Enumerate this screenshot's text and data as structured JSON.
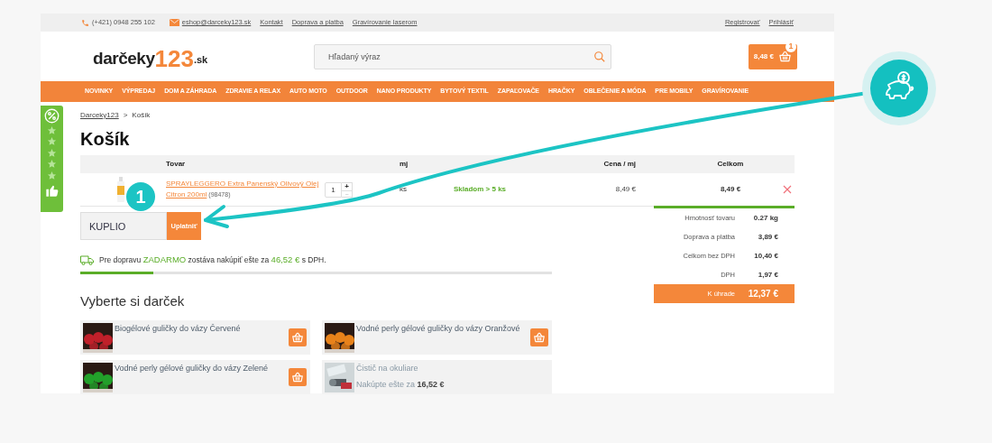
{
  "topbar": {
    "phone": "(+421) 0948 255 102",
    "email": "eshop@darceky123.sk",
    "links": [
      "Kontakt",
      "Doprava a platba",
      "Gravírovanie laserom"
    ],
    "account_links": [
      "Registrovať",
      "Prihlásiť"
    ]
  },
  "header": {
    "logo": {
      "name": "darčeky",
      "number": "123",
      "tld": ".sk"
    },
    "search": {
      "placeholder": "Hľadaný výraz"
    },
    "cart": {
      "total": "8,48 €",
      "count": "1"
    }
  },
  "nav": [
    "NOVINKY",
    "VÝPREDAJ",
    "DOM A ZÁHRADA",
    "ZDRAVIE A RELAX",
    "AUTO MOTO",
    "OUTDOOR",
    "NANO PRODUKTY",
    "BYTOVÝ TEXTIL",
    "ZAPAĽOVAČE",
    "HRAČKY",
    "OBLEČENIE A MÓDA",
    "PRE MOBILY",
    "GRAVÍROVANIE"
  ],
  "breadcrumb": {
    "items": [
      "Darceky123",
      "Košík"
    ],
    "separator": ">"
  },
  "title": "Košík",
  "table": {
    "columns": {
      "product": "Tovar",
      "unit": "mj",
      "price": "Cena / mj",
      "total": "Celkom"
    },
    "rows": [
      {
        "name": "SPRAYLEGGERO Extra Panenský Olivový Olej Citron 200ml",
        "code": "(98478)",
        "qty": "1",
        "plus": "+",
        "minus": "−",
        "unit": "ks",
        "stock": "Skladom > 5 ks",
        "price": "8,49 €",
        "total": "8,49 €"
      }
    ]
  },
  "coupon": {
    "value": "KUPLIO",
    "button": "Uplatniť"
  },
  "shipping": {
    "prefix": "Pre dopravu",
    "highlight": "ZADARMO",
    "middle": "zostáva nakúpiť ešte za",
    "amount": "46,52 €",
    "suffix": "s DPH.",
    "level": 0.155
  },
  "summary": {
    "rows": [
      {
        "label": "Hmotnosť tovaru",
        "value": "0.27 kg"
      },
      {
        "label": "Doprava a platba",
        "value": "3,89 €"
      },
      {
        "label": "Celkom bez DPH",
        "value": "10,40 €"
      },
      {
        "label": "DPH",
        "value": "1,97 €"
      }
    ],
    "total": {
      "label": "K úhrade",
      "value": "12,37 €"
    }
  },
  "gifts": {
    "title": "Vyberte si darček",
    "items": [
      {
        "kind": "available",
        "name": "Biogélové guličky do vázy Červené"
      },
      {
        "kind": "available",
        "name": "Vodné perly gélové guličky do vázy Oranžové"
      },
      {
        "kind": "available",
        "name": "Vodné perly gélové guličky do vázy Zelené"
      },
      {
        "kind": "locked",
        "name": "Čistič na okuliare",
        "note": "Nakúpte ešte za **16,52 €**"
      }
    ]
  },
  "annotation": {
    "step": "1"
  }
}
